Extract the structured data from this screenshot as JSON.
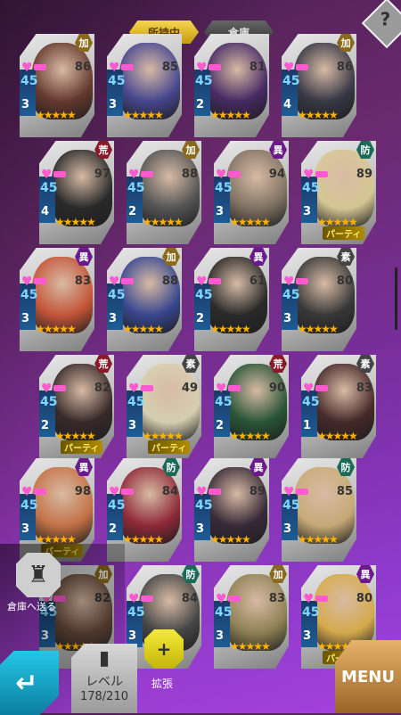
{
  "tabs": {
    "owned": "所持中",
    "storage": "倉庫"
  },
  "help": "?",
  "cards": [
    {
      "race": "加",
      "race_color": "#8a6a1a",
      "level": "86",
      "slot": "3",
      "art": "#5b2b1e",
      "party": false
    },
    {
      "race": "",
      "race_color": "#444",
      "level": "85",
      "slot": "3",
      "art": "#3a3a8a",
      "party": false
    },
    {
      "race": "",
      "race_color": "#444",
      "level": "81",
      "slot": "2",
      "art": "#3a1a5a",
      "party": false
    },
    {
      "race": "加",
      "race_color": "#8a6a1a",
      "level": "86",
      "slot": "4",
      "art": "#2a2a3a",
      "party": false
    },
    {
      "race": "荒",
      "race_color": "#8a1a2a",
      "level": "97",
      "slot": "4",
      "art": "#1a1a1a",
      "party": false
    },
    {
      "race": "加",
      "race_color": "#8a6a1a",
      "level": "88",
      "slot": "2",
      "art": "#4a4a4a",
      "party": false
    },
    {
      "race": "異",
      "race_color": "#6a1a8a",
      "level": "94",
      "slot": "3",
      "art": "#7a6a5a",
      "party": false
    },
    {
      "race": "防",
      "race_color": "#1a6a5a",
      "level": "89",
      "slot": "3",
      "art": "#d8c890",
      "party": true
    },
    {
      "race": "異",
      "race_color": "#6a1a8a",
      "level": "83",
      "slot": "3",
      "art": "#c44a2a",
      "party": false
    },
    {
      "race": "加",
      "race_color": "#8a6a1a",
      "level": "88",
      "slot": "3",
      "art": "#2a3a8a",
      "party": false
    },
    {
      "race": "異",
      "race_color": "#6a1a8a",
      "level": "61",
      "slot": "2",
      "art": "#1a1a1a",
      "party": false
    },
    {
      "race": "素",
      "race_color": "#444",
      "level": "80",
      "slot": "3",
      "art": "#2a2a2a",
      "party": false
    },
    {
      "race": "荒",
      "race_color": "#8a1a2a",
      "level": "82",
      "slot": "2",
      "art": "#2a1a1a",
      "party": true
    },
    {
      "race": "素",
      "race_color": "#444",
      "level": "49",
      "slot": "3",
      "art": "#d8d0b0",
      "party": true
    },
    {
      "race": "荒",
      "race_color": "#8a1a2a",
      "level": "90",
      "slot": "2",
      "art": "#1a4a2a",
      "party": false
    },
    {
      "race": "素",
      "race_color": "#444",
      "level": "83",
      "slot": "1",
      "art": "#3a1a1a",
      "party": false
    },
    {
      "race": "異",
      "race_color": "#6a1a8a",
      "level": "98",
      "slot": "3",
      "art": "#c46a3a",
      "party": true
    },
    {
      "race": "防",
      "race_color": "#1a6a5a",
      "level": "84",
      "slot": "2",
      "art": "#8a1a2a",
      "party": false
    },
    {
      "race": "異",
      "race_color": "#6a1a8a",
      "level": "89",
      "slot": "3",
      "art": "#2a1a2a",
      "party": false
    },
    {
      "race": "防",
      "race_color": "#1a6a5a",
      "level": "85",
      "slot": "3",
      "art": "#c8a870",
      "party": false
    },
    {
      "race": "加",
      "race_color": "#8a6a1a",
      "level": "82",
      "slot": "3",
      "art": "#5a3a2a",
      "party": false
    },
    {
      "race": "防",
      "race_color": "#1a6a5a",
      "level": "84",
      "slot": "3",
      "art": "#3a3a3a",
      "party": false
    },
    {
      "race": "加",
      "race_color": "#8a6a1a",
      "level": "83",
      "slot": "3",
      "art": "#8a7a4a",
      "party": false
    },
    {
      "race": "異",
      "race_color": "#6a1a8a",
      "level": "80",
      "slot": "3",
      "art": "#d8a840",
      "party": true
    }
  ],
  "party_label": "パーティ",
  "unit_level": "45",
  "stars": "★★★★★",
  "bottom": {
    "send_storage": "倉庫へ送る",
    "level_label": "レベル",
    "level_value": "178/210",
    "expand": "拡張",
    "menu": "MENU"
  }
}
